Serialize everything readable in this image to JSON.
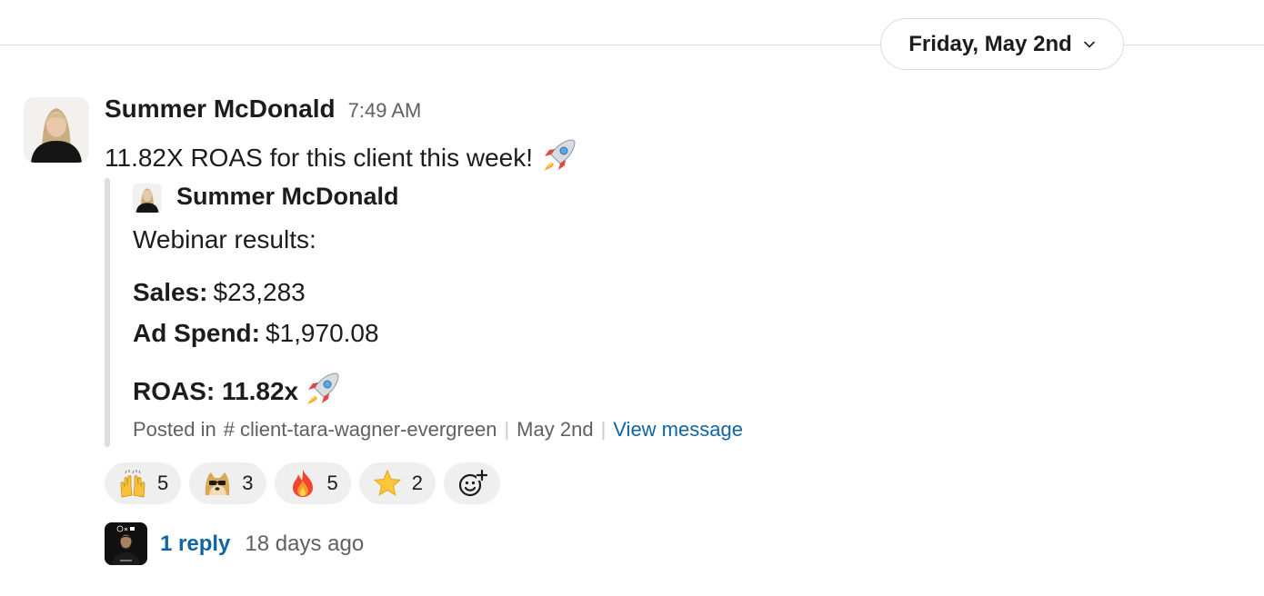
{
  "date_divider": {
    "label": "Friday, May 2nd"
  },
  "message": {
    "author": "Summer McDonald",
    "time": "7:49 AM",
    "text": "11.82X ROAS for this client this week!",
    "emoji": "rocket"
  },
  "quoted": {
    "author": "Summer McDonald",
    "intro": "Webinar results:",
    "sales_label": "Sales:",
    "sales_value": "$23,283",
    "adspend_label": "Ad Spend:",
    "adspend_value": "$1,970.08",
    "roas_label": "ROAS: 11.82x",
    "meta": {
      "posted_in": "Posted in",
      "hash": "#",
      "channel": "client-tara-wagner-evergreen",
      "date": "May 2nd",
      "link": "View message"
    }
  },
  "reactions": [
    {
      "icon": "raised-hands",
      "count": "5"
    },
    {
      "icon": "cool-doge",
      "count": "3"
    },
    {
      "icon": "fire",
      "count": "5"
    },
    {
      "icon": "star",
      "count": "2"
    }
  ],
  "thread": {
    "replies": "1 reply",
    "time": "18 days ago"
  },
  "colors": {
    "link": "#1264a3",
    "muted": "#616061",
    "reaction_bg": "#efefef",
    "quote_bar": "#dddddd"
  }
}
